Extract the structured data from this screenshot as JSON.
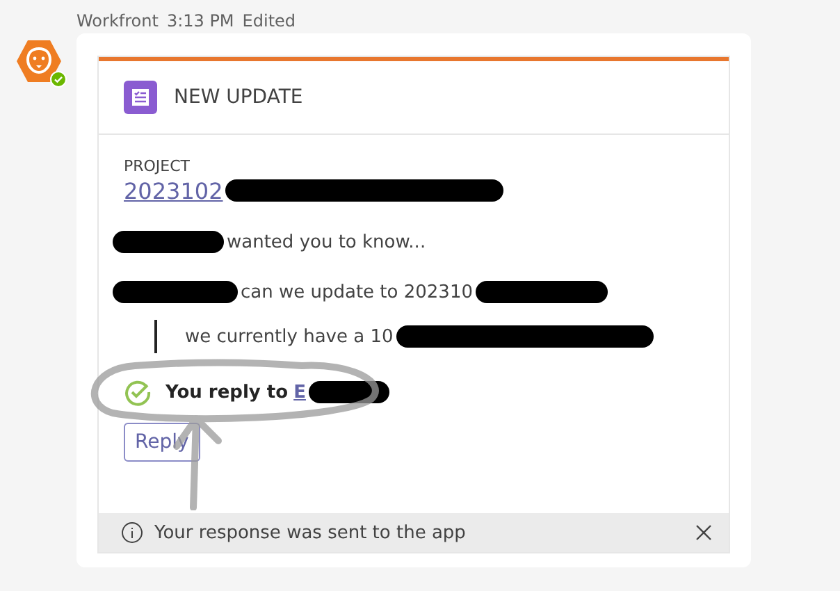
{
  "message": {
    "sender": "Workfront",
    "time": "3:13 PM",
    "status": "Edited",
    "avatar_online": true
  },
  "card": {
    "title": "NEW UPDATE",
    "project_label": "PROJECT",
    "project_link": [
      {
        "kind": "link",
        "text": "2023102"
      },
      {
        "kind": "redacted"
      }
    ],
    "lines": [
      {
        "kind": "plain",
        "segments": [
          {
            "kind": "redacted"
          },
          {
            "kind": "text",
            "text": "wanted you to know..."
          }
        ]
      },
      {
        "kind": "plain",
        "segments": [
          {
            "kind": "redacted"
          },
          {
            "kind": "text",
            "text": "can we update to 202310"
          },
          {
            "kind": "redacted"
          }
        ]
      },
      {
        "kind": "quote",
        "segments": [
          {
            "kind": "text",
            "text": "we currently have a 10"
          },
          {
            "kind": "redacted"
          }
        ]
      }
    ],
    "reply_status": {
      "text": "You reply to",
      "link": "E"
    },
    "button": "Reply"
  },
  "notice": {
    "text": "Your response was sent to the app"
  }
}
